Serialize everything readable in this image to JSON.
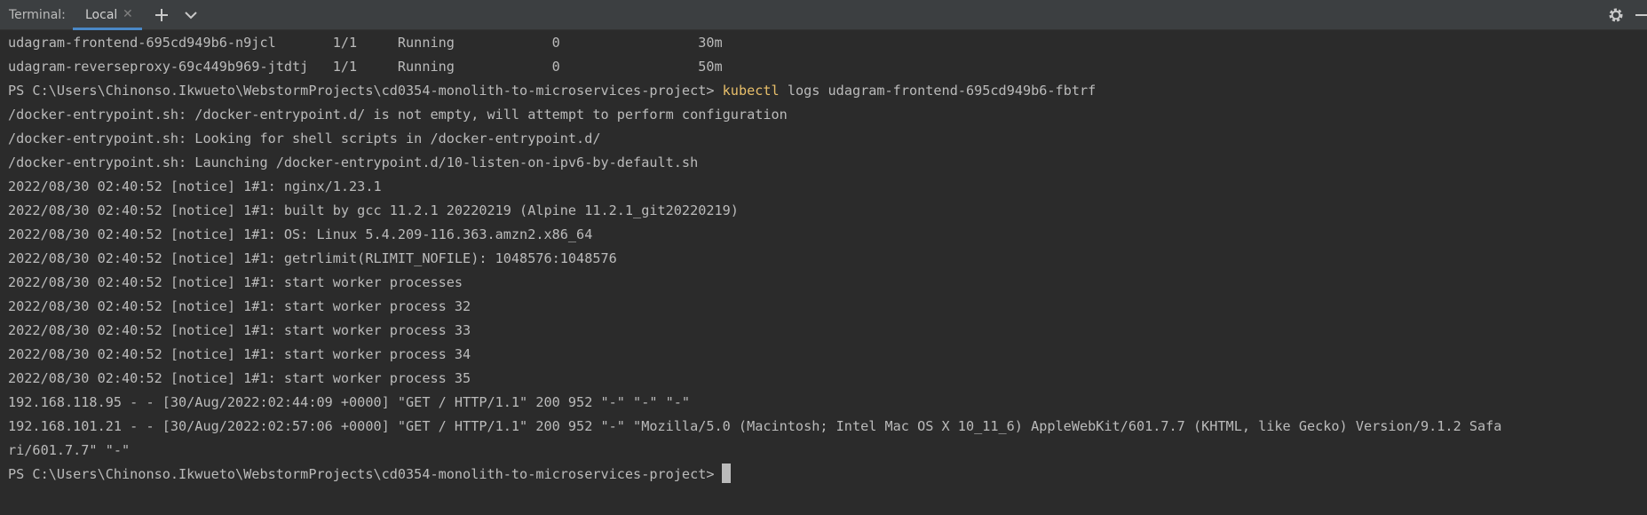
{
  "toolbar": {
    "title": "Terminal:",
    "tab_label": "Local",
    "tab_close_icon": "close-icon",
    "add_icon": "plus-icon",
    "dropdown_icon": "chevron-down-icon",
    "settings_icon": "gear-icon",
    "minimize_icon": "minimize-icon"
  },
  "terminal": {
    "pods": [
      {
        "text": "udagram-frontend-695cd949b6-n9jcl       1/1     Running            0                 30m"
      },
      {
        "text": "udagram-reverseproxy-69c449b969-jtdtj   1/1     Running            0                 50m"
      }
    ],
    "prompt1": "PS C:\\Users\\Chinonso.Ikwueto\\WebstormProjects\\cd0354-monolith-to-microservices-project> ",
    "command_keyword": "kubectl",
    "command_rest": " logs udagram-frontend-695cd949b6-fbtrf",
    "log_lines": [
      "/docker-entrypoint.sh: /docker-entrypoint.d/ is not empty, will attempt to perform configuration",
      "/docker-entrypoint.sh: Looking for shell scripts in /docker-entrypoint.d/",
      "/docker-entrypoint.sh: Launching /docker-entrypoint.d/10-listen-on-ipv6-by-default.sh",
      "2022/08/30 02:40:52 [notice] 1#1: nginx/1.23.1",
      "2022/08/30 02:40:52 [notice] 1#1: built by gcc 11.2.1 20220219 (Alpine 11.2.1_git20220219)",
      "2022/08/30 02:40:52 [notice] 1#1: OS: Linux 5.4.209-116.363.amzn2.x86_64",
      "2022/08/30 02:40:52 [notice] 1#1: getrlimit(RLIMIT_NOFILE): 1048576:1048576",
      "2022/08/30 02:40:52 [notice] 1#1: start worker processes",
      "2022/08/30 02:40:52 [notice] 1#1: start worker process 32",
      "2022/08/30 02:40:52 [notice] 1#1: start worker process 33",
      "2022/08/30 02:40:52 [notice] 1#1: start worker process 34",
      "2022/08/30 02:40:52 [notice] 1#1: start worker process 35",
      "192.168.118.95 - - [30/Aug/2022:02:44:09 +0000] \"GET / HTTP/1.1\" 200 952 \"-\" \"-\" \"-\"",
      "192.168.101.21 - - [30/Aug/2022:02:57:06 +0000] \"GET / HTTP/1.1\" 200 952 \"-\" \"Mozilla/5.0 (Macintosh; Intel Mac OS X 10_11_6) AppleWebKit/601.7.7 (KHTML, like Gecko) Version/9.1.2 Safa",
      "ri/601.7.7\" \"-\""
    ],
    "prompt2": "PS C:\\Users\\Chinonso.Ikwueto\\WebstormProjects\\cd0354-monolith-to-microservices-project>"
  },
  "colors": {
    "background": "#2b2b2b",
    "toolbar": "#3c3f41",
    "text": "#bbbbbb",
    "command": "#e8bf6a",
    "tab_underline": "#4a88c7"
  }
}
